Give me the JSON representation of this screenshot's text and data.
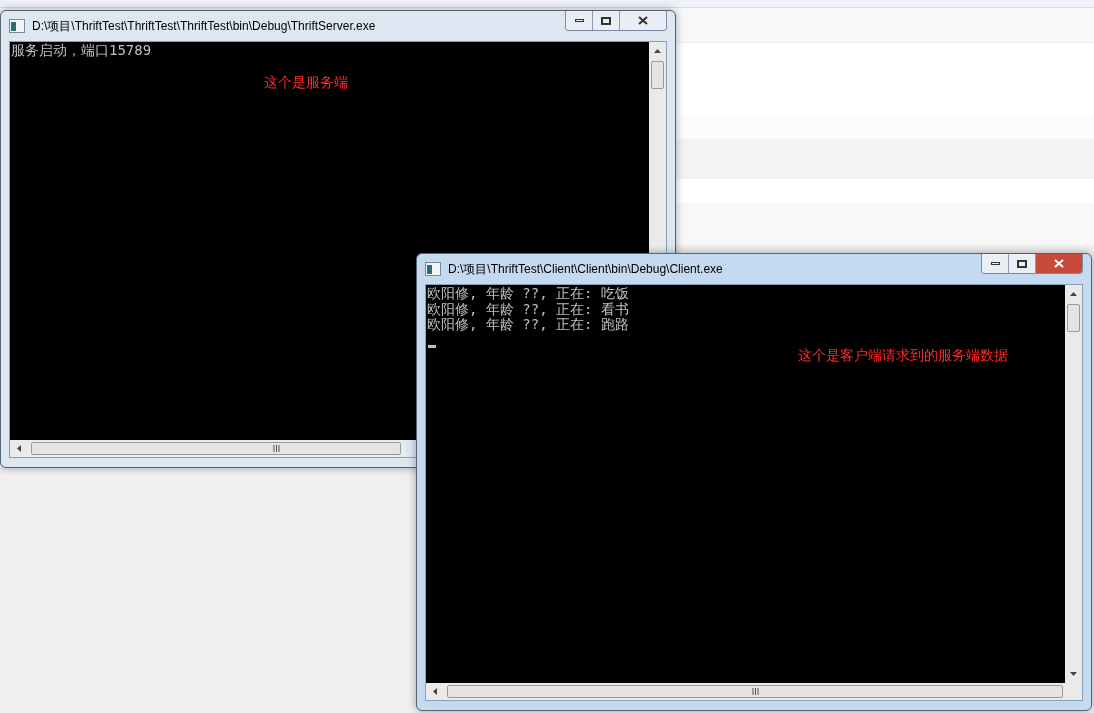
{
  "windows": [
    {
      "title": "D:\\项目\\ThriftTest\\ThriftTest\\ThriftTest\\bin\\Debug\\ThriftServer.exe",
      "active": false,
      "lines": [
        "服务启动，端口15789"
      ],
      "annotation": "这个是服务端",
      "cursor": false
    },
    {
      "title": "D:\\项目\\ThriftTest\\Client\\Client\\bin\\Debug\\Client.exe",
      "active": true,
      "lines": [
        "欧阳修, 年龄 ??, 正在: 吃饭",
        "欧阳修, 年龄 ??, 正在: 看书",
        "欧阳修, 年龄 ??, 正在: 跑路"
      ],
      "annotation": "这个是客户端请求到的服务端数据",
      "cursor": true
    }
  ]
}
